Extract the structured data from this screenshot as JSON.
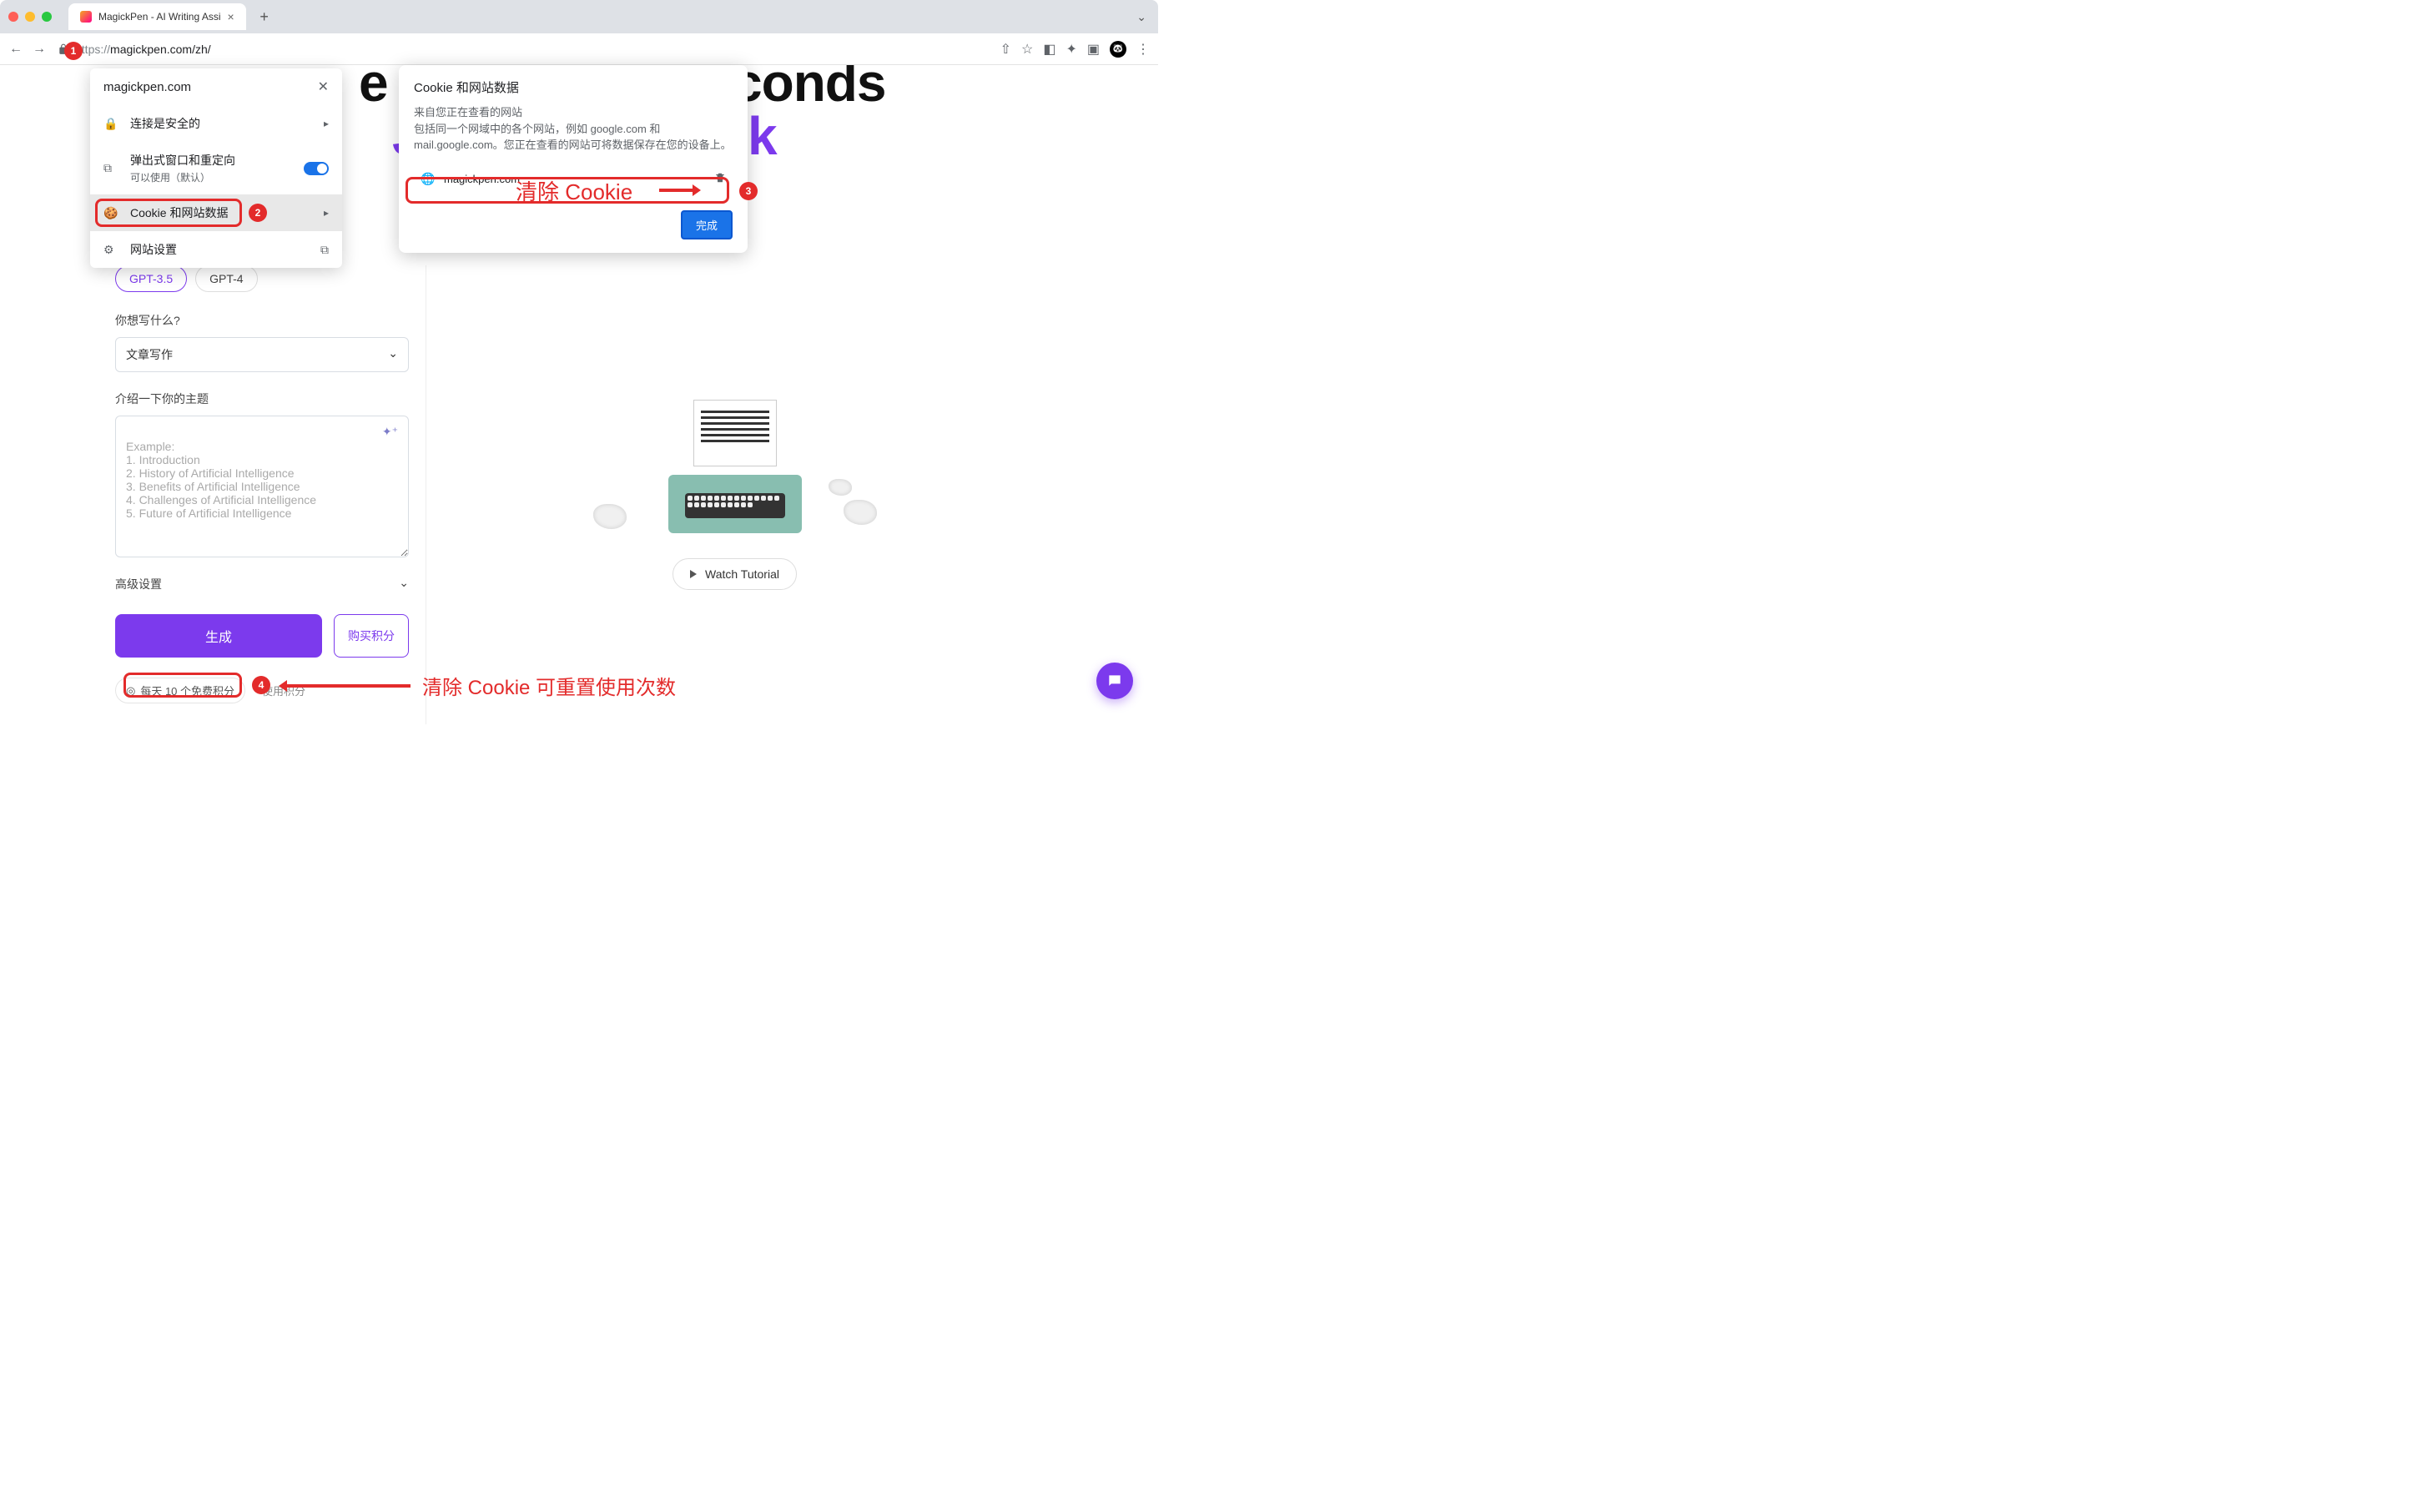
{
  "browser": {
    "tab_title": "MagickPen - AI Writing Assi",
    "url_scheme": "https://",
    "url_rest": "magickpen.com/zh/"
  },
  "siteinfo": {
    "domain": "magickpen.com",
    "secure": "连接是安全的",
    "popups": "弹出式窗口和重定向",
    "popups_sub": "可以使用（默认）",
    "cookies": "Cookie 和网站数据",
    "settings": "网站设置"
  },
  "cookiepop": {
    "title": "Cookie 和网站数据",
    "subtitle1": "来自您正在查看的网站",
    "subtitle2": "包括同一个网域中的各个网站，例如 google.com 和 mail.google.com。您正在查看的网站可将数据保存在您的设备上。",
    "site": "magickpen.com",
    "done": "完成"
  },
  "annotations": {
    "m1": "1",
    "m2": "2",
    "m3": "3",
    "m4": "4",
    "clear_cookie": "清除 Cookie",
    "reset_text": "清除 Cookie 可重置使用次数"
  },
  "page": {
    "hero_left": "e",
    "hero_mid1": "J",
    "hero_mid2": "k",
    "hero_right": "conds",
    "model1": "GPT-3.5",
    "model2": "GPT-4",
    "q_what": "你想写什么?",
    "select_val": "文章写作",
    "q_topic": "介绍一下你的主题",
    "placeholder": "Example:\n1. Introduction\n2. History of Artificial Intelligence\n3. Benefits of Artificial Intelligence\n4. Challenges of Artificial Intelligence\n5. Future of Artificial Intelligence",
    "advanced": "高级设置",
    "generate": "生成",
    "buy": "购买积分",
    "credits": "每天 10 个免费积分",
    "hint_right": "使用积分",
    "watch": "Watch Tutorial"
  }
}
